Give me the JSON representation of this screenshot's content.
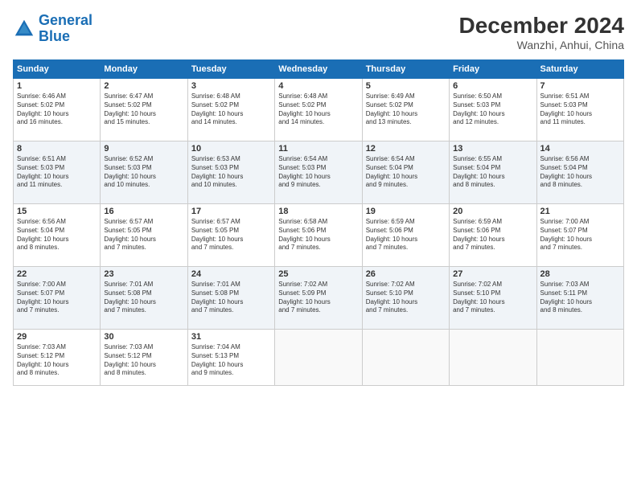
{
  "header": {
    "logo_line1": "General",
    "logo_line2": "Blue",
    "month": "December 2024",
    "location": "Wanzhi, Anhui, China"
  },
  "weekdays": [
    "Sunday",
    "Monday",
    "Tuesday",
    "Wednesday",
    "Thursday",
    "Friday",
    "Saturday"
  ],
  "weeks": [
    [
      {
        "day": "1",
        "info": "Sunrise: 6:46 AM\nSunset: 5:02 PM\nDaylight: 10 hours\nand 16 minutes."
      },
      {
        "day": "2",
        "info": "Sunrise: 6:47 AM\nSunset: 5:02 PM\nDaylight: 10 hours\nand 15 minutes."
      },
      {
        "day": "3",
        "info": "Sunrise: 6:48 AM\nSunset: 5:02 PM\nDaylight: 10 hours\nand 14 minutes."
      },
      {
        "day": "4",
        "info": "Sunrise: 6:48 AM\nSunset: 5:02 PM\nDaylight: 10 hours\nand 14 minutes."
      },
      {
        "day": "5",
        "info": "Sunrise: 6:49 AM\nSunset: 5:02 PM\nDaylight: 10 hours\nand 13 minutes."
      },
      {
        "day": "6",
        "info": "Sunrise: 6:50 AM\nSunset: 5:03 PM\nDaylight: 10 hours\nand 12 minutes."
      },
      {
        "day": "7",
        "info": "Sunrise: 6:51 AM\nSunset: 5:03 PM\nDaylight: 10 hours\nand 11 minutes."
      }
    ],
    [
      {
        "day": "8",
        "info": "Sunrise: 6:51 AM\nSunset: 5:03 PM\nDaylight: 10 hours\nand 11 minutes."
      },
      {
        "day": "9",
        "info": "Sunrise: 6:52 AM\nSunset: 5:03 PM\nDaylight: 10 hours\nand 10 minutes."
      },
      {
        "day": "10",
        "info": "Sunrise: 6:53 AM\nSunset: 5:03 PM\nDaylight: 10 hours\nand 10 minutes."
      },
      {
        "day": "11",
        "info": "Sunrise: 6:54 AM\nSunset: 5:03 PM\nDaylight: 10 hours\nand 9 minutes."
      },
      {
        "day": "12",
        "info": "Sunrise: 6:54 AM\nSunset: 5:04 PM\nDaylight: 10 hours\nand 9 minutes."
      },
      {
        "day": "13",
        "info": "Sunrise: 6:55 AM\nSunset: 5:04 PM\nDaylight: 10 hours\nand 8 minutes."
      },
      {
        "day": "14",
        "info": "Sunrise: 6:56 AM\nSunset: 5:04 PM\nDaylight: 10 hours\nand 8 minutes."
      }
    ],
    [
      {
        "day": "15",
        "info": "Sunrise: 6:56 AM\nSunset: 5:04 PM\nDaylight: 10 hours\nand 8 minutes."
      },
      {
        "day": "16",
        "info": "Sunrise: 6:57 AM\nSunset: 5:05 PM\nDaylight: 10 hours\nand 7 minutes."
      },
      {
        "day": "17",
        "info": "Sunrise: 6:57 AM\nSunset: 5:05 PM\nDaylight: 10 hours\nand 7 minutes."
      },
      {
        "day": "18",
        "info": "Sunrise: 6:58 AM\nSunset: 5:06 PM\nDaylight: 10 hours\nand 7 minutes."
      },
      {
        "day": "19",
        "info": "Sunrise: 6:59 AM\nSunset: 5:06 PM\nDaylight: 10 hours\nand 7 minutes."
      },
      {
        "day": "20",
        "info": "Sunrise: 6:59 AM\nSunset: 5:06 PM\nDaylight: 10 hours\nand 7 minutes."
      },
      {
        "day": "21",
        "info": "Sunrise: 7:00 AM\nSunset: 5:07 PM\nDaylight: 10 hours\nand 7 minutes."
      }
    ],
    [
      {
        "day": "22",
        "info": "Sunrise: 7:00 AM\nSunset: 5:07 PM\nDaylight: 10 hours\nand 7 minutes."
      },
      {
        "day": "23",
        "info": "Sunrise: 7:01 AM\nSunset: 5:08 PM\nDaylight: 10 hours\nand 7 minutes."
      },
      {
        "day": "24",
        "info": "Sunrise: 7:01 AM\nSunset: 5:08 PM\nDaylight: 10 hours\nand 7 minutes."
      },
      {
        "day": "25",
        "info": "Sunrise: 7:02 AM\nSunset: 5:09 PM\nDaylight: 10 hours\nand 7 minutes."
      },
      {
        "day": "26",
        "info": "Sunrise: 7:02 AM\nSunset: 5:10 PM\nDaylight: 10 hours\nand 7 minutes."
      },
      {
        "day": "27",
        "info": "Sunrise: 7:02 AM\nSunset: 5:10 PM\nDaylight: 10 hours\nand 7 minutes."
      },
      {
        "day": "28",
        "info": "Sunrise: 7:03 AM\nSunset: 5:11 PM\nDaylight: 10 hours\nand 8 minutes."
      }
    ],
    [
      {
        "day": "29",
        "info": "Sunrise: 7:03 AM\nSunset: 5:12 PM\nDaylight: 10 hours\nand 8 minutes."
      },
      {
        "day": "30",
        "info": "Sunrise: 7:03 AM\nSunset: 5:12 PM\nDaylight: 10 hours\nand 8 minutes."
      },
      {
        "day": "31",
        "info": "Sunrise: 7:04 AM\nSunset: 5:13 PM\nDaylight: 10 hours\nand 9 minutes."
      },
      {
        "day": "",
        "info": ""
      },
      {
        "day": "",
        "info": ""
      },
      {
        "day": "",
        "info": ""
      },
      {
        "day": "",
        "info": ""
      }
    ]
  ]
}
